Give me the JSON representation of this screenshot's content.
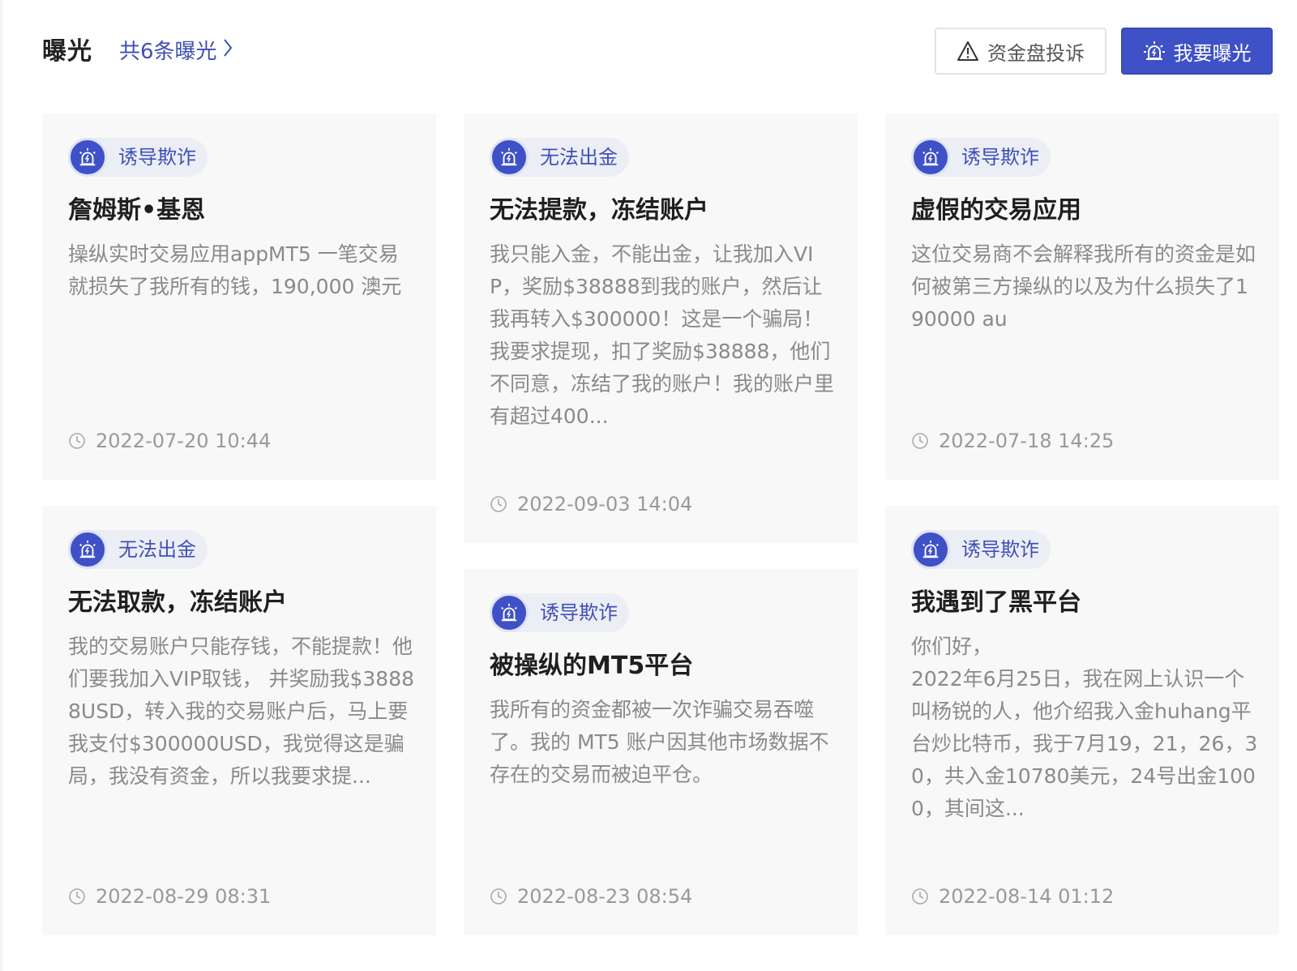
{
  "header": {
    "title": "曝光",
    "count_link": "共6条曝光",
    "complaint_button": "资金盘投诉",
    "expose_button": "我要曝光"
  },
  "cards": [
    {
      "tag": "诱导欺诈",
      "title": "詹姆斯•基恩",
      "body": "操纵实时交易应用appMT5 一笔交易就损失了我所有的钱，190,000 澳元",
      "time": "2022-07-20 10:44"
    },
    {
      "tag": "无法出金",
      "title": "无法提款，冻结账户",
      "body": "我只能入金，不能出金，让我加入VIP，奖励$38888到我的账户，然后让我再转入$300000！这是一个骗局！我要求提现，扣了奖励$38888，他们不同意，冻结了我的账户！我的账户里有超过400...",
      "time": "2022-09-03 14:04"
    },
    {
      "tag": "诱导欺诈",
      "title": "虚假的交易应用",
      "body": "这位交易商不会解释我所有的资金是如何被第三方操纵的以及为什么损失了190000 au",
      "time": "2022-07-18 14:25"
    },
    {
      "tag": "无法出金",
      "title": "无法取款，冻结账户",
      "body": "我的交易账户只能存钱，不能提款！他们要我加入VIP取钱， 并奖励我$38888USD，转入我的交易账户后，马上要我支付$300000USD，我觉得这是骗局，我没有资金，所以我要求提...",
      "time": "2022-08-29 08:31"
    },
    {
      "tag": "诱导欺诈",
      "title": "被操纵的MT5平台",
      "body": "我所有的资金都被一次诈骗交易吞噬了。我的 MT5 账户因其他市场数据不存在的交易而被迫平仓。",
      "time": "2022-08-23 08:54"
    },
    {
      "tag": "诱导欺诈",
      "title": "我遇到了黑平台",
      "body": "你们好，\n2022年6月25日，我在网上认识一个叫杨锐的人，他介绍我入金huhang平台炒比特币，我于7月19，21，26，30，共入金10780美元，24号出金1000，其间这...",
      "time": "2022-08-14 01:12"
    }
  ],
  "colors": {
    "accent": "#3f51c7",
    "card_bg": "#f8f8f9",
    "tag_bg": "#eceef6"
  },
  "icons": {
    "tag": "siren-icon",
    "complaint": "warning-icon",
    "expose": "siren-icon",
    "time": "clock-icon",
    "count_link": "chevron-right-icon"
  }
}
